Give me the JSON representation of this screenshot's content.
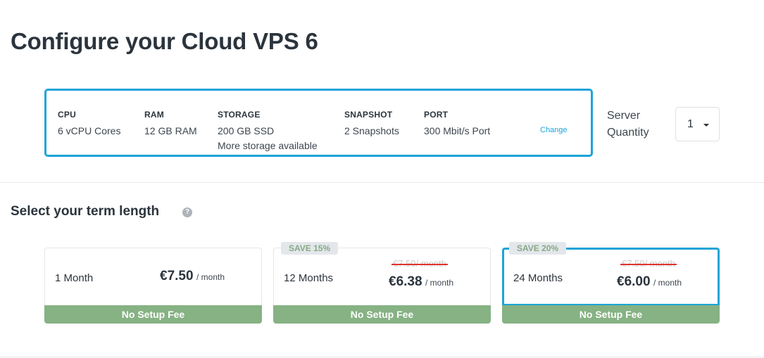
{
  "page": {
    "title": "Configure your Cloud VPS 6"
  },
  "specs": {
    "items": [
      {
        "label": "CPU",
        "value": "6 vCPU Cores"
      },
      {
        "label": "RAM",
        "value": "12 GB RAM"
      },
      {
        "label": "STORAGE",
        "value": "200 GB SSD",
        "extra": "More storage available"
      },
      {
        "label": "SNAPSHOT",
        "value": "2 Snapshots"
      },
      {
        "label": "PORT",
        "value": "300 Mbit/s Port"
      }
    ],
    "change_label": "Change"
  },
  "quantity": {
    "label": "Server Quantity",
    "value": "1"
  },
  "term": {
    "title": "Select your term length",
    "help_glyph": "?",
    "selected_index": 2,
    "options": [
      {
        "name": "1 Month",
        "price": "€7.50",
        "unit": "/ month",
        "old_price": "",
        "badge": "",
        "setup": "No Setup Fee"
      },
      {
        "name": "12 Months",
        "price": "€6.38",
        "unit": "/ month",
        "old_price": "€7.50/ month",
        "badge": "SAVE 15%",
        "setup": "No Setup Fee"
      },
      {
        "name": "24 Months",
        "price": "€6.00",
        "unit": "/ month",
        "old_price": "€7.50/ month",
        "badge": "SAVE 20%",
        "setup": "No Setup Fee"
      }
    ]
  },
  "colors": {
    "accent": "#1ca4d8",
    "setup_bar": "#86b284",
    "strike": "#e0322c"
  }
}
